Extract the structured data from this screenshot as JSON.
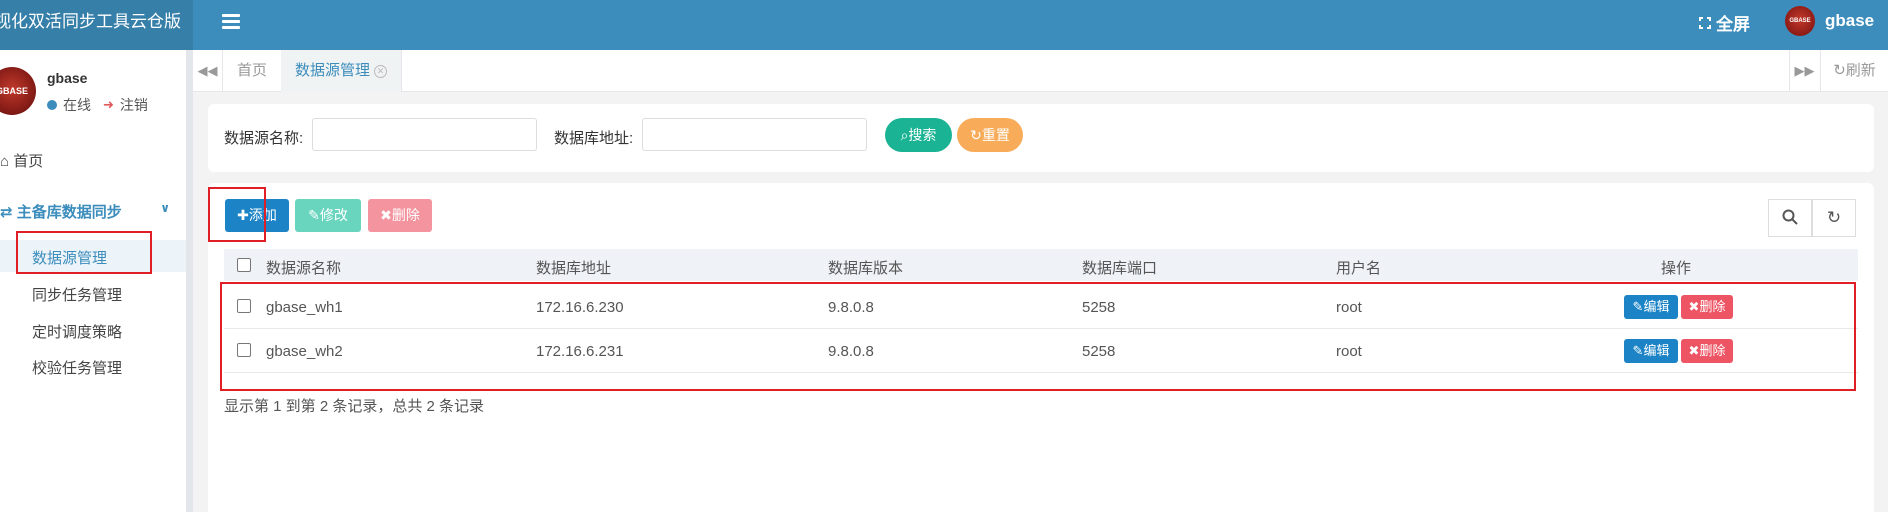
{
  "app": {
    "title": "视化双活同步工具云仓版"
  },
  "header": {
    "fullscreen_label": "全屏",
    "username": "gbase",
    "avatar_text": "GBASE"
  },
  "sidebar": {
    "avatar_text": "GBASE",
    "username": "gbase",
    "status_label": "在线",
    "logout_label": "注销",
    "home_label": "首页",
    "group_label": "主备库数据同步",
    "items": [
      {
        "label": "数据源管理"
      },
      {
        "label": "同步任务管理"
      },
      {
        "label": "定时调度策略"
      },
      {
        "label": "校验任务管理"
      }
    ]
  },
  "tabs": {
    "items": [
      {
        "label": "首页"
      },
      {
        "label": "数据源管理"
      }
    ],
    "refresh_label": "刷新"
  },
  "search": {
    "name_label": "数据源名称:",
    "name_value": "",
    "address_label": "数据库地址:",
    "address_value": "",
    "search_label": "搜索",
    "reset_label": "重置"
  },
  "toolbar": {
    "add_label": "添加",
    "edit_label": "修改",
    "delete_label": "删除"
  },
  "table": {
    "columns": [
      "数据源名称",
      "数据库地址",
      "数据库版本",
      "数据库端口",
      "用户名",
      "操作"
    ],
    "rows": [
      {
        "name": "gbase_wh1",
        "address": "172.16.6.230",
        "version": "9.8.0.8",
        "port": "5258",
        "user": "root",
        "edit": "编辑",
        "delete": "删除"
      },
      {
        "name": "gbase_wh2",
        "address": "172.16.6.231",
        "version": "9.8.0.8",
        "port": "5258",
        "user": "root",
        "edit": "编辑",
        "delete": "删除"
      }
    ],
    "summary": "显示第 1 到第 2 条记录，总共 2 条记录"
  },
  "colors": {
    "primary": "#3c8dbc",
    "brand_dark": "#367fa9",
    "add": "#1c84c6",
    "edit": "#5ad1b7",
    "delete": "#f3949f",
    "search": "#1ab394",
    "reset": "#f8ac59",
    "danger": "#ed5565",
    "highlight": "#e01e26"
  }
}
